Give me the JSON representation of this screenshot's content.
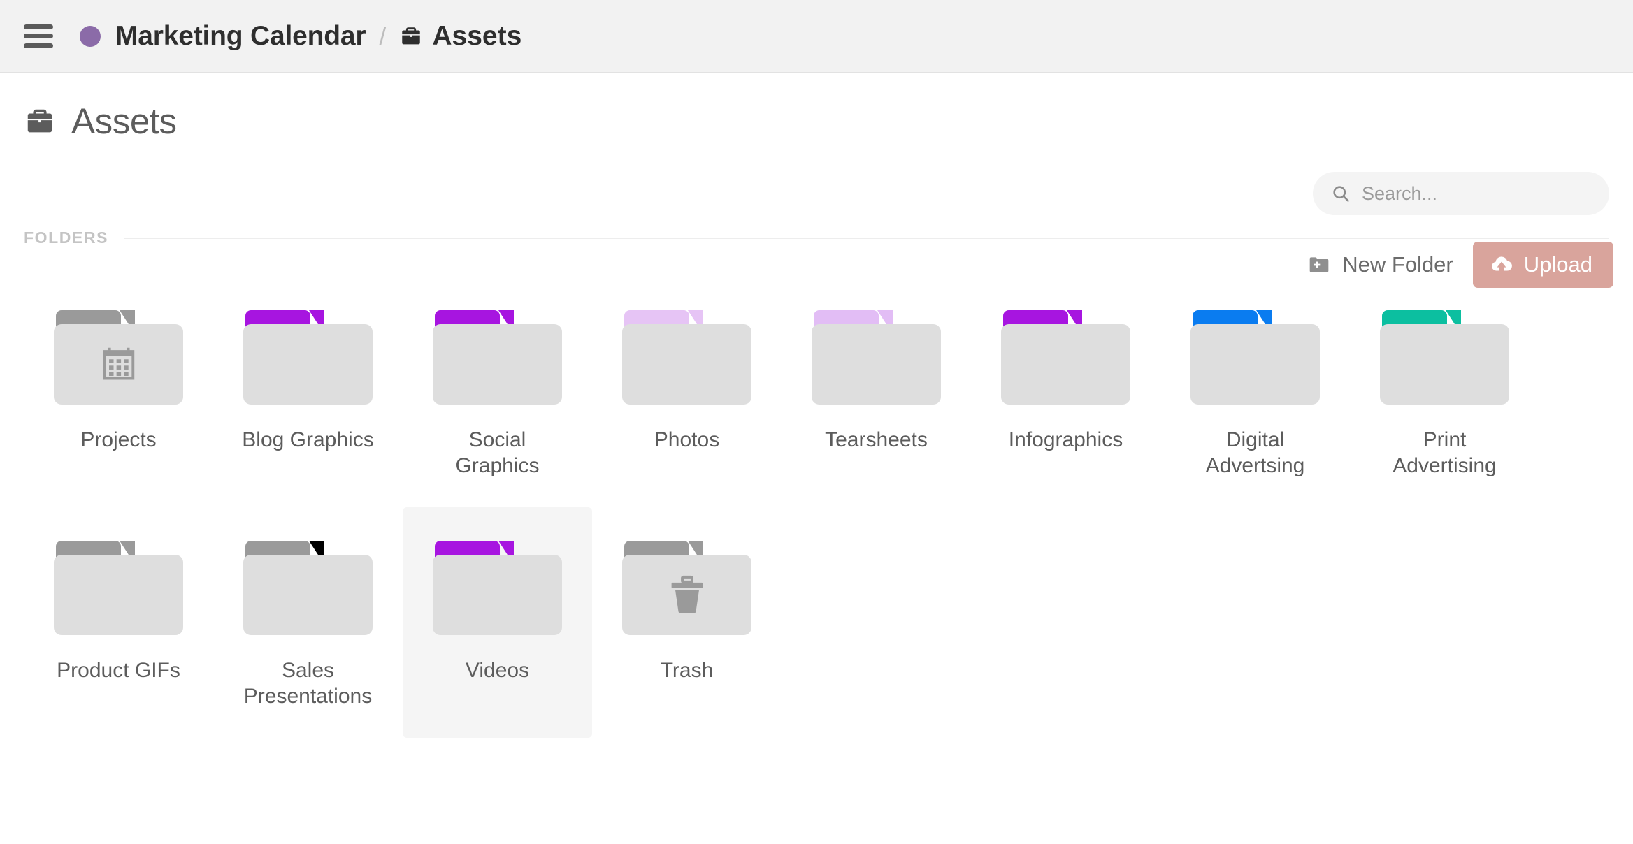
{
  "topbar": {
    "menu_icon": "hamburger-icon",
    "space_dot_color": "#8b6ba8",
    "space_name": "Marketing Calendar",
    "separator": "/",
    "page_icon": "briefcase-icon",
    "page_name": "Assets"
  },
  "header": {
    "icon": "briefcase-icon",
    "title": "Assets"
  },
  "search": {
    "icon": "search-icon",
    "placeholder": "Search...",
    "value": ""
  },
  "toolbar": {
    "new_folder_icon": "folder-plus-icon",
    "new_folder_label": "New Folder",
    "upload_icon": "cloud-upload-icon",
    "upload_label": "Upload",
    "upload_color": "#d9a49c"
  },
  "section": {
    "folders_label": "FOLDERS"
  },
  "folders": [
    {
      "name": "Projects",
      "tab_color": "#9a9a9a",
      "inner_icon": "calendar-icon",
      "selected": false
    },
    {
      "name": "Blog Graphics",
      "tab_color": "#a715e0",
      "inner_icon": "",
      "selected": false
    },
    {
      "name": "Social Graphics",
      "tab_color": "#a715e0",
      "inner_icon": "",
      "selected": false
    },
    {
      "name": "Photos",
      "tab_color": "#e6c4f5",
      "inner_icon": "",
      "selected": false
    },
    {
      "name": "Tearsheets",
      "tab_color": "#e2bdf5",
      "inner_icon": "",
      "selected": false
    },
    {
      "name": "Infographics",
      "tab_color": "#a715e0",
      "inner_icon": "",
      "selected": false
    },
    {
      "name": "Digital Advertsing",
      "tab_color": "#0a7cf0",
      "inner_icon": "",
      "selected": false
    },
    {
      "name": "Print Advertising",
      "tab_color": "#0cbfa0",
      "inner_icon": "",
      "selected": false
    },
    {
      "name": "Product GIFs",
      "tab_color": "#9a9a9a",
      "inner_icon": "",
      "selected": false
    },
    {
      "name": "Sales Presentations",
      "tab_color": "#74c川",
      "inner_icon": "",
      "selected": false
    },
    {
      "name": "Videos",
      "tab_color": "#a715e0",
      "inner_icon": "",
      "selected": true
    },
    {
      "name": "Trash",
      "tab_color": "#9a9a9a",
      "inner_icon": "trash-icon",
      "selected": false
    }
  ]
}
